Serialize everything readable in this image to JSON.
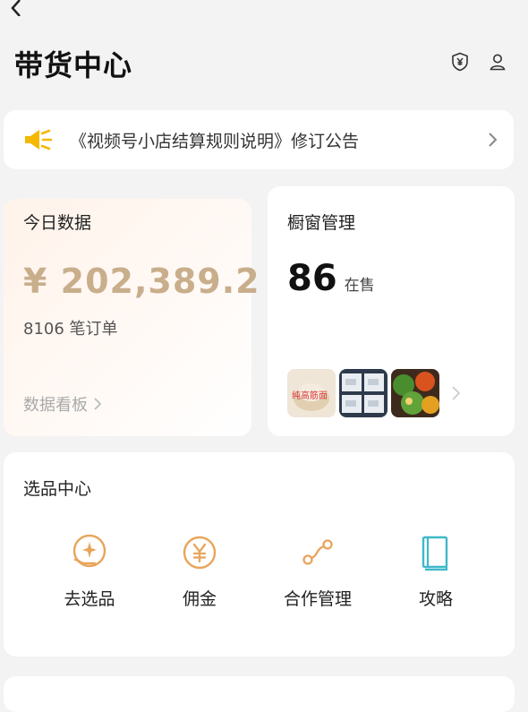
{
  "header": {
    "title": "带货中心"
  },
  "notice": {
    "text": "《视频号小店结算规则说明》修订公告"
  },
  "today": {
    "title": "今日数据",
    "amount": "¥ 202,389.2",
    "orders": "8106 笔订单",
    "dashboard_link": "数据看板"
  },
  "showcase": {
    "title": "橱窗管理",
    "count": "86",
    "unit": "在售",
    "thumbnails": [
      "product-image",
      "product-image",
      "product-image"
    ],
    "thumb1_caption": "纯高筋面"
  },
  "selection": {
    "title": "选品中心",
    "items": [
      {
        "label": "去选品",
        "icon": "pick-products-icon"
      },
      {
        "label": "佣金",
        "icon": "yen-coin-icon"
      },
      {
        "label": "合作管理",
        "icon": "link-nodes-icon"
      },
      {
        "label": "攻略",
        "icon": "book-icon"
      }
    ]
  },
  "colors": {
    "accent_gold": "#c9ae8c",
    "icon_orange": "#e8a55a",
    "icon_teal": "#3fb8c9",
    "speaker_yellow": "#f5b800"
  }
}
